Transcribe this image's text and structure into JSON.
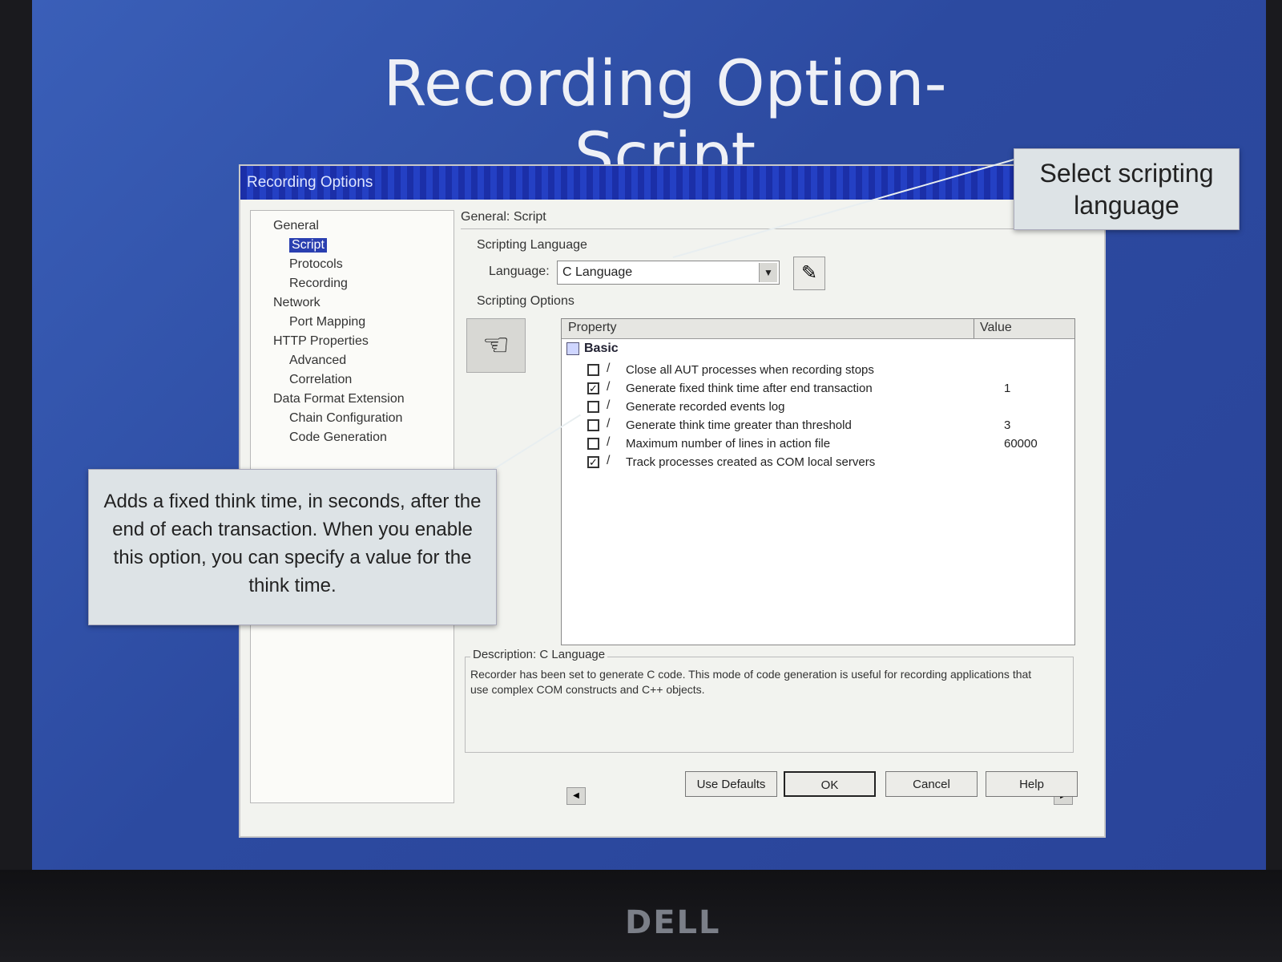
{
  "slide": {
    "title": "Recording Option-Script"
  },
  "dialog": {
    "title": "Recording Options",
    "tree": [
      {
        "label": "General",
        "level": 0
      },
      {
        "label": "Script",
        "level": 1,
        "selected": true
      },
      {
        "label": "Protocols",
        "level": 1
      },
      {
        "label": "Recording",
        "level": 1
      },
      {
        "label": "Network",
        "level": 0
      },
      {
        "label": "Port Mapping",
        "level": 1
      },
      {
        "label": "HTTP Properties",
        "level": 0
      },
      {
        "label": "Advanced",
        "level": 1
      },
      {
        "label": "Correlation",
        "level": 1
      },
      {
        "label": "Data Format Extension",
        "level": 0
      },
      {
        "label": "Chain Configuration",
        "level": 1
      },
      {
        "label": "Code Generation",
        "level": 1
      }
    ],
    "breadcrumb": "General: Script",
    "scripting_language_group": "Scripting Language",
    "language_label": "Language:",
    "language_value": "C Language",
    "scripting_options_group": "Scripting Options",
    "grid": {
      "col_property": "Property",
      "col_value": "Value",
      "group": "Basic",
      "rows": [
        {
          "label": "Close all AUT processes when recording stops",
          "checked": false,
          "value": ""
        },
        {
          "label": "Generate fixed think time after end transaction",
          "checked": true,
          "value": "1"
        },
        {
          "label": "Generate recorded events log",
          "checked": false,
          "value": ""
        },
        {
          "label": "Generate think time greater than threshold",
          "checked": false,
          "value": "3"
        },
        {
          "label": "Maximum number of lines in action file",
          "checked": false,
          "value": "60000"
        },
        {
          "label": "Track processes created as COM local servers",
          "checked": true,
          "value": ""
        }
      ]
    },
    "description": {
      "title": "Description: C Language",
      "text": "Recorder has been set to generate C code. This mode of code generation is useful for recording applications that use complex COM constructs and C++ objects."
    },
    "buttons": {
      "use_defaults": "Use Defaults",
      "ok": "OK",
      "cancel": "Cancel",
      "help": "Help"
    }
  },
  "callouts": {
    "language": "Select scripting language",
    "think_time": "Adds a fixed think time, in seconds, after the end of each transaction. When you enable this option, you can specify a value for the think time."
  },
  "bezel": {
    "brand": "DELL"
  }
}
